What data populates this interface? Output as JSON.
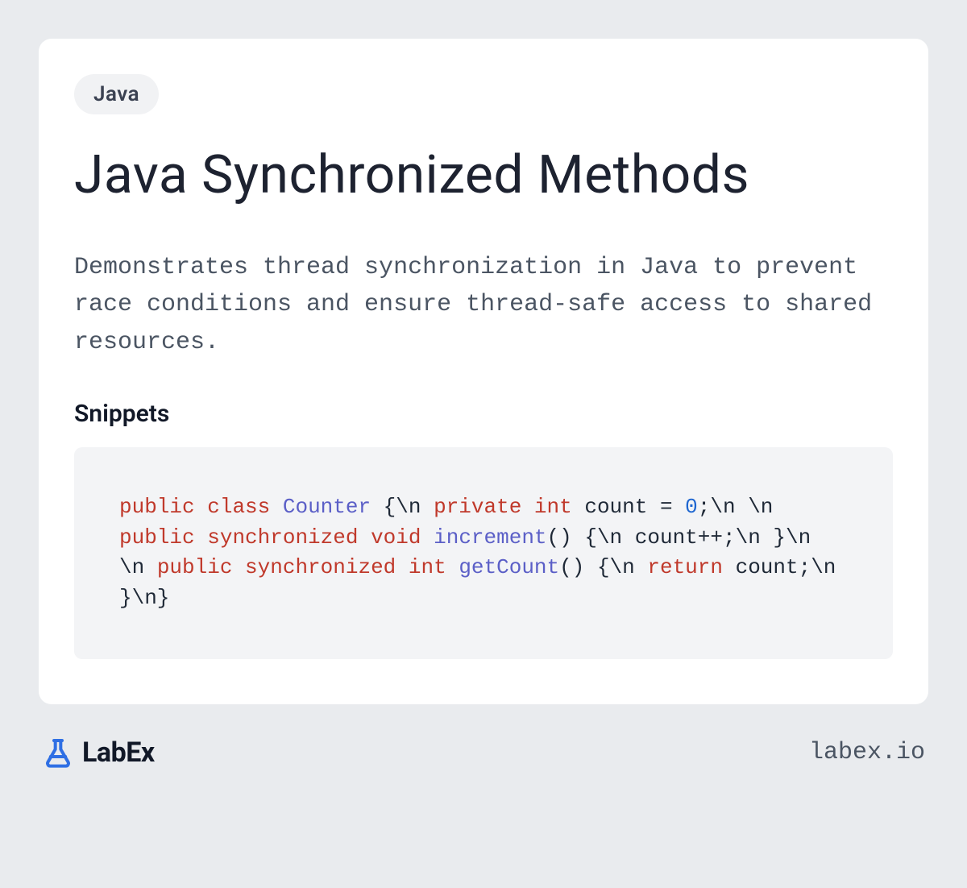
{
  "tag": "Java",
  "title": "Java Synchronized Methods",
  "description": "Demonstrates thread synchronization in Java to prevent race conditions and ensure thread-safe access to shared resources.",
  "snippets_heading": "Snippets",
  "code": {
    "tokens": [
      {
        "t": "public",
        "c": "kw"
      },
      {
        "t": " "
      },
      {
        "t": "class",
        "c": "kw"
      },
      {
        "t": " "
      },
      {
        "t": "Counter",
        "c": "cls"
      },
      {
        "t": " {\\n    "
      },
      {
        "t": "private",
        "c": "kw"
      },
      {
        "t": " "
      },
      {
        "t": "int",
        "c": "kw"
      },
      {
        "t": " count = "
      },
      {
        "t": "0",
        "c": "num"
      },
      {
        "t": ";\\n    \\n    "
      },
      {
        "t": "public",
        "c": "kw"
      },
      {
        "t": " "
      },
      {
        "t": "synchronized",
        "c": "kw"
      },
      {
        "t": " "
      },
      {
        "t": "void",
        "c": "kw"
      },
      {
        "t": " "
      },
      {
        "t": "increment",
        "c": "fn"
      },
      {
        "t": "() {\\n        count++;\\n    }\\n    \\n    "
      },
      {
        "t": "public",
        "c": "kw"
      },
      {
        "t": " "
      },
      {
        "t": "synchronized",
        "c": "kw"
      },
      {
        "t": " "
      },
      {
        "t": "int",
        "c": "kw"
      },
      {
        "t": " "
      },
      {
        "t": "getCount",
        "c": "fn"
      },
      {
        "t": "() {\\n        "
      },
      {
        "t": "return",
        "c": "kw"
      },
      {
        "t": " count;\\n    }\\n}"
      }
    ]
  },
  "brand": "LabEx",
  "site": "labex.io"
}
